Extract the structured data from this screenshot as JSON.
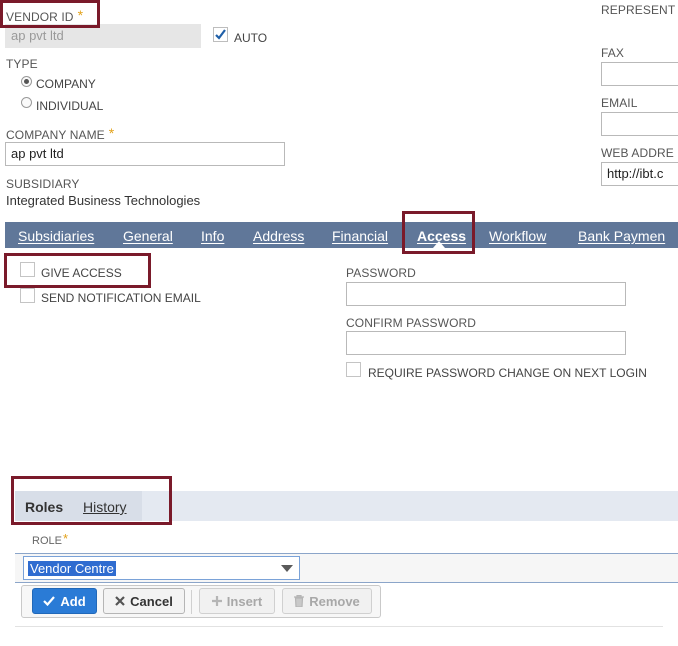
{
  "header": {
    "vendor_id_label": "VENDOR ID",
    "vendor_id_value": "ap pvt ltd",
    "auto_label": "AUTO",
    "represent_label": "REPRESENT",
    "type_label": "TYPE",
    "type_options": [
      "COMPANY",
      "INDIVIDUAL"
    ],
    "company_name_label": "COMPANY NAME",
    "company_name_value": "ap pvt ltd",
    "subsidiary_label": "SUBSIDIARY",
    "subsidiary_value": "Integrated Business Technologies",
    "fax_label": "FAX",
    "email_label": "EMAIL",
    "web_address_label": "WEB ADDRE",
    "web_address_value": "http://ibt.c"
  },
  "tabs": [
    "Subsidiaries",
    "General",
    "Info",
    "Address",
    "Financial",
    "Access",
    "Workflow",
    "Bank Paymen"
  ],
  "access": {
    "give_access_label": "GIVE ACCESS",
    "send_notification_label": "SEND NOTIFICATION EMAIL",
    "password_label": "PASSWORD",
    "confirm_password_label": "CONFIRM PASSWORD",
    "require_change_label": "REQUIRE PASSWORD CHANGE ON NEXT LOGIN"
  },
  "subtabs": [
    "Roles",
    "History"
  ],
  "roles": {
    "role_label": "ROLE",
    "role_value": "Vendor Centre",
    "buttons": {
      "add": "Add",
      "cancel": "Cancel",
      "insert": "Insert",
      "remove": "Remove"
    }
  },
  "colors": {
    "tab_bar": "#607799",
    "highlight": "#7a1a2a",
    "primary_button": "#2a7bd6",
    "required": "#e3a21a"
  }
}
